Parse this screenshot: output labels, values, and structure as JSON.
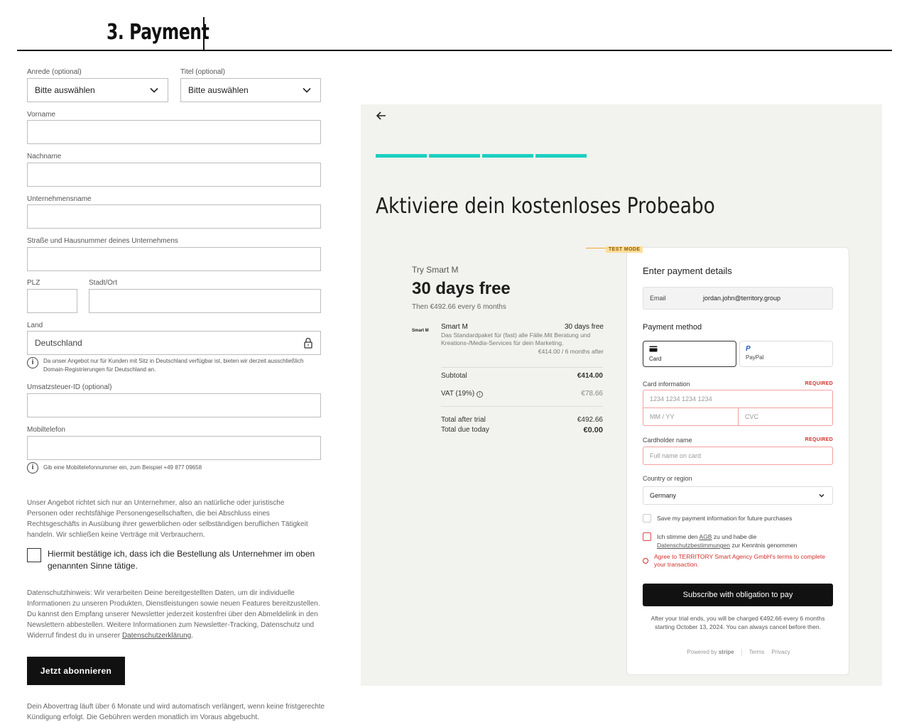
{
  "page": {
    "heading": "3.  Payment"
  },
  "form": {
    "anrede": {
      "label": "Anrede (optional)",
      "value": "Bitte auswählen"
    },
    "titel": {
      "label": "Titel (optional)",
      "value": "Bitte auswählen"
    },
    "vorname_label": "Vorname",
    "nachname_label": "Nachname",
    "unternehmen_label": "Unternehmensname",
    "strasse_label": "Straße und Hausnummer deines Unternehmens",
    "plz_label": "PLZ",
    "stadt_label": "Stadt/Ort",
    "land": {
      "label": "Land",
      "value": "Deutschland"
    },
    "land_info": "Da unser Angebot nur für Kunden mit Sitz in Deutschland verfügbar ist, bieten wir derzeit ausschließlich Domain-Registrierungen für Deutschland an.",
    "ust_label": "Umsatzsteuer-ID (optional)",
    "mobil_label": "Mobiltelefon",
    "mobil_info": "Gib eine Mobiltelefonnummer ein, zum Beispiel +49 877 09658",
    "b2b_notice": "Unser Angebot richtet sich nur an Unternehmer, also an natürliche oder juristische Personen oder rechtsfähige Personengesellschaften, die bei Abschluss eines Rechtsgeschäfts in Ausübung ihrer gewerblichen oder selbständigen beruflichen Tätigkeit handeln. Wir schließen keine Verträge mit Verbrauchern.",
    "b2b_checkbox": "Hiermit bestätige ich, dass ich die Bestellung als Unternehmer im oben genannten Sinne tätige.",
    "privacy_text": "Datenschutzhinweis: Wir verarbeiten Deine bereitgestellten Daten, um dir individuelle Informationen zu unseren Produkten, Dienstleistungen sowie neuen Features bereitzustellen. Du kannst den Empfang unserer Newsletter jederzeit kostenfrei über den Abmeldelink in den Newslettern abbestellen. Weitere Informationen zum Newsletter-Tracking, Datenschutz und Widerruf findest du in unserer",
    "privacy_link": "Datenschutzerklärung",
    "privacy_end": ".",
    "submit_label": "Jetzt abonnieren",
    "contract_text": "Dein Abovertrag läuft über 6 Monate und wird automatisch verlängert, wenn keine fristgerechte Kündigung erfolgt. Die Gebühren werden monatlich im Voraus abgebucht."
  },
  "checkout": {
    "title": "Aktiviere dein kostenloses Probeabo",
    "progress_steps": 4,
    "summary": {
      "try": "Try Smart M",
      "headline": "30 days free",
      "then": "Then €492.66 every 6 months",
      "item_logo": "Smart M",
      "item_name": "Smart M",
      "item_price": "30 days free",
      "item_desc": "Das Standardpaket für (fast) alle Fälle.Mit Beratung und Kreations-/Media-Services für dein Marketing.",
      "item_after": "€414.00 / 6 months after",
      "subtotal_label": "Subtotal",
      "subtotal_value": "€414.00",
      "vat_label": "VAT (19%)",
      "vat_value": "€78.66",
      "total_after_label": "Total after trial",
      "total_after_value": "€492.66",
      "total_today_label": "Total due today",
      "total_today_value": "€0.00"
    },
    "test_mode": "TEST MODE",
    "payment": {
      "title": "Enter payment details",
      "email_label": "Email",
      "email_value": "jordan.john@territory.group",
      "method_title": "Payment method",
      "card_tab": "Card",
      "paypal_tab": "PayPal",
      "card_info_label": "Card information",
      "required": "REQUIRED",
      "card_number_placeholder": "1234 1234 1234 1234",
      "expiry_placeholder": "MM / YY",
      "cvc_placeholder": "CVC",
      "cardholder_label": "Cardholder name",
      "cardholder_placeholder": "Full name on card",
      "country_label": "Country or region",
      "country_value": "Germany",
      "save_info": "Save my payment information for future purchases",
      "terms_prefix": "Ich stimme den ",
      "terms_agb": "AGB",
      "terms_middle": " zu und habe die ",
      "terms_privacy": "Datenschutzbestimmungen",
      "terms_suffix": " zur Kenntnis genommen",
      "terms_error": "Agree to TERRITORY Smart Agency GmbH's terms to complete your transaction.",
      "subscribe_label": "Subscribe with obligation to pay",
      "fine_print": "After your trial ends, you will be charged €492.66 every 6 months starting October 13, 2024. You can always cancel before then.",
      "powered_by": "Powered by",
      "stripe": "stripe",
      "terms_link": "Terms",
      "privacy_link": "Privacy"
    }
  }
}
